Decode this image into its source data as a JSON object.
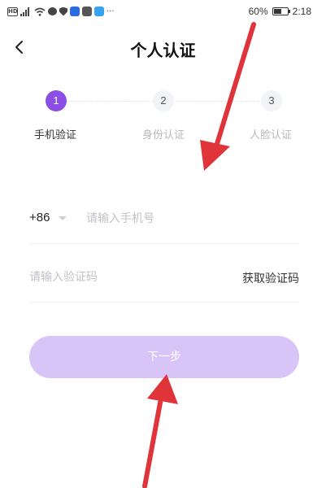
{
  "status_bar": {
    "hd": "HD",
    "battery_text": "60%",
    "battery_level": 0.6,
    "time": "2:18",
    "more": "···"
  },
  "header": {
    "title": "个人认证",
    "back_icon": "chevron-left-icon"
  },
  "steps": [
    {
      "number": "1",
      "label": "手机验证",
      "active": true
    },
    {
      "number": "2",
      "label": "身份认证",
      "active": false
    },
    {
      "number": "3",
      "label": "人脸认证",
      "active": false
    }
  ],
  "form": {
    "country_code": "+86",
    "phone_placeholder": "请输入手机号",
    "code_placeholder": "请输入验证码",
    "get_code_label": "获取验证码",
    "next_label": "下一步"
  },
  "colors": {
    "accent": "#8b4fe6",
    "button_disabled": "#d8c4f6",
    "annotation_arrow": "#e0343b"
  }
}
